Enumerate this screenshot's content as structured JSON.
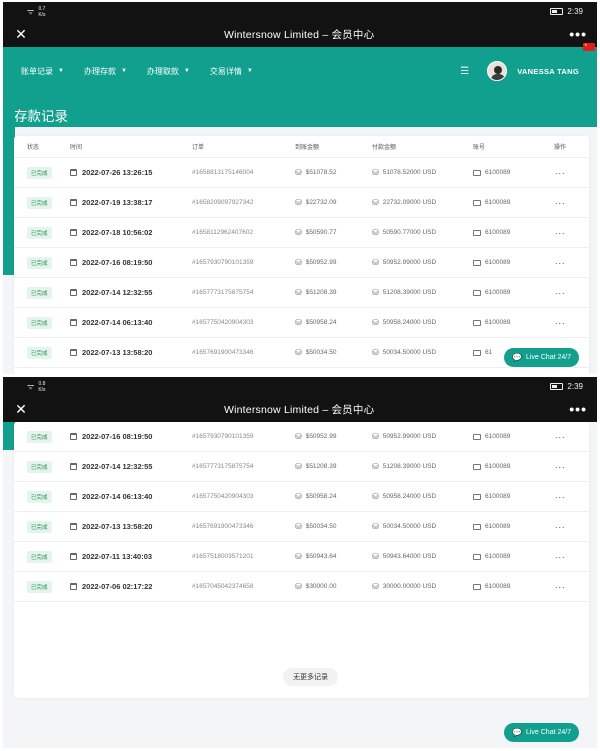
{
  "app": {
    "title": "Wintersnow Limited – 会员中心",
    "close_glyph": "✕",
    "more_glyph": "•••"
  },
  "statusbar": {
    "shot1": {
      "speed": "0.7\nK/s",
      "time": "2:39"
    },
    "shot2": {
      "speed": "0.8\nK/s",
      "time": "2:39"
    }
  },
  "nav": {
    "items": [
      {
        "label": "账单记录",
        "icon": "chevron-down-icon"
      },
      {
        "label": "办理存款",
        "icon": "chevron-down-icon"
      },
      {
        "label": "办理取款",
        "icon": "chevron-down-icon"
      },
      {
        "label": "交易详情",
        "icon": "chevron-down-icon"
      }
    ],
    "menu_glyph": "☰",
    "user_name": "VANESSA TANG"
  },
  "page_title": "存款记录",
  "table": {
    "headers": {
      "status": "状态",
      "time": "时间",
      "order": "订单",
      "received": "到账金额",
      "paid": "付款金额",
      "account": "账号",
      "action": "操作"
    },
    "rows_shot1": [
      {
        "status": "已完成",
        "time": "2022-07-26 13:26:15",
        "order": "#1658813175146004",
        "received": "$51078.52",
        "paid": "51078.52000 USD",
        "account": "6100089",
        "action": "···"
      },
      {
        "status": "已完成",
        "time": "2022-07-19 13:38:17",
        "order": "#1658209097927342",
        "received": "$22732.09",
        "paid": "22732.09000 USD",
        "account": "6100089",
        "action": "···"
      },
      {
        "status": "已完成",
        "time": "2022-07-18 10:56:02",
        "order": "#1658112962407602",
        "received": "$50590.77",
        "paid": "50590.77000 USD",
        "account": "6100089",
        "action": "···"
      },
      {
        "status": "已完成",
        "time": "2022-07-16 08:19:50",
        "order": "#1657930790101359",
        "received": "$50952.99",
        "paid": "50952.99000 USD",
        "account": "6100089",
        "action": "···"
      },
      {
        "status": "已完成",
        "time": "2022-07-14 12:32:55",
        "order": "#1657773175875754",
        "received": "$51208.39",
        "paid": "51208.39000 USD",
        "account": "6100089",
        "action": "···"
      },
      {
        "status": "已完成",
        "time": "2022-07-14 06:13:40",
        "order": "#1657750420904303",
        "received": "$50958.24",
        "paid": "50958.24000 USD",
        "account": "6100089",
        "action": "···"
      },
      {
        "status": "已完成",
        "time": "2022-07-13 13:58:20",
        "order": "#1657691900473346",
        "received": "$50034.50",
        "paid": "50034.50000 USD",
        "account": "61",
        "action": ""
      }
    ],
    "rows_shot2": [
      {
        "status": "已完成",
        "time": "2022-07-16 08:19:50",
        "order": "#1657930790101359",
        "received": "$50952.99",
        "paid": "50952.99000 USD",
        "account": "6100089",
        "action": "···"
      },
      {
        "status": "已完成",
        "time": "2022-07-14 12:32:55",
        "order": "#1657773175875754",
        "received": "$51208.39",
        "paid": "51208.39000 USD",
        "account": "6100089",
        "action": "···"
      },
      {
        "status": "已完成",
        "time": "2022-07-14 06:13:40",
        "order": "#1657750420904303",
        "received": "$50958.24",
        "paid": "50958.24000 USD",
        "account": "6100089",
        "action": "···"
      },
      {
        "status": "已完成",
        "time": "2022-07-13 13:58:20",
        "order": "#1657691900473346",
        "received": "$50034.50",
        "paid": "50034.50000 USD",
        "account": "6100089",
        "action": "···"
      },
      {
        "status": "已完成",
        "time": "2022-07-11 13:40:03",
        "order": "#1657518003571201",
        "received": "$50943.64",
        "paid": "50943.64000 USD",
        "account": "6100089",
        "action": "···"
      },
      {
        "status": "已完成",
        "time": "2022-07-06 02:17:22",
        "order": "#1657045042374658",
        "received": "$30000.00",
        "paid": "30000.00000 USD",
        "account": "6100089",
        "action": "···"
      }
    ]
  },
  "no_more_label": "无更多记录",
  "chat": {
    "label": "Live Chat 24/7",
    "icon": "chat-bubble-icon"
  },
  "colors": {
    "brand": "#12a08e",
    "status_bg": "#e3f5ec",
    "status_text": "#2c8a55"
  }
}
